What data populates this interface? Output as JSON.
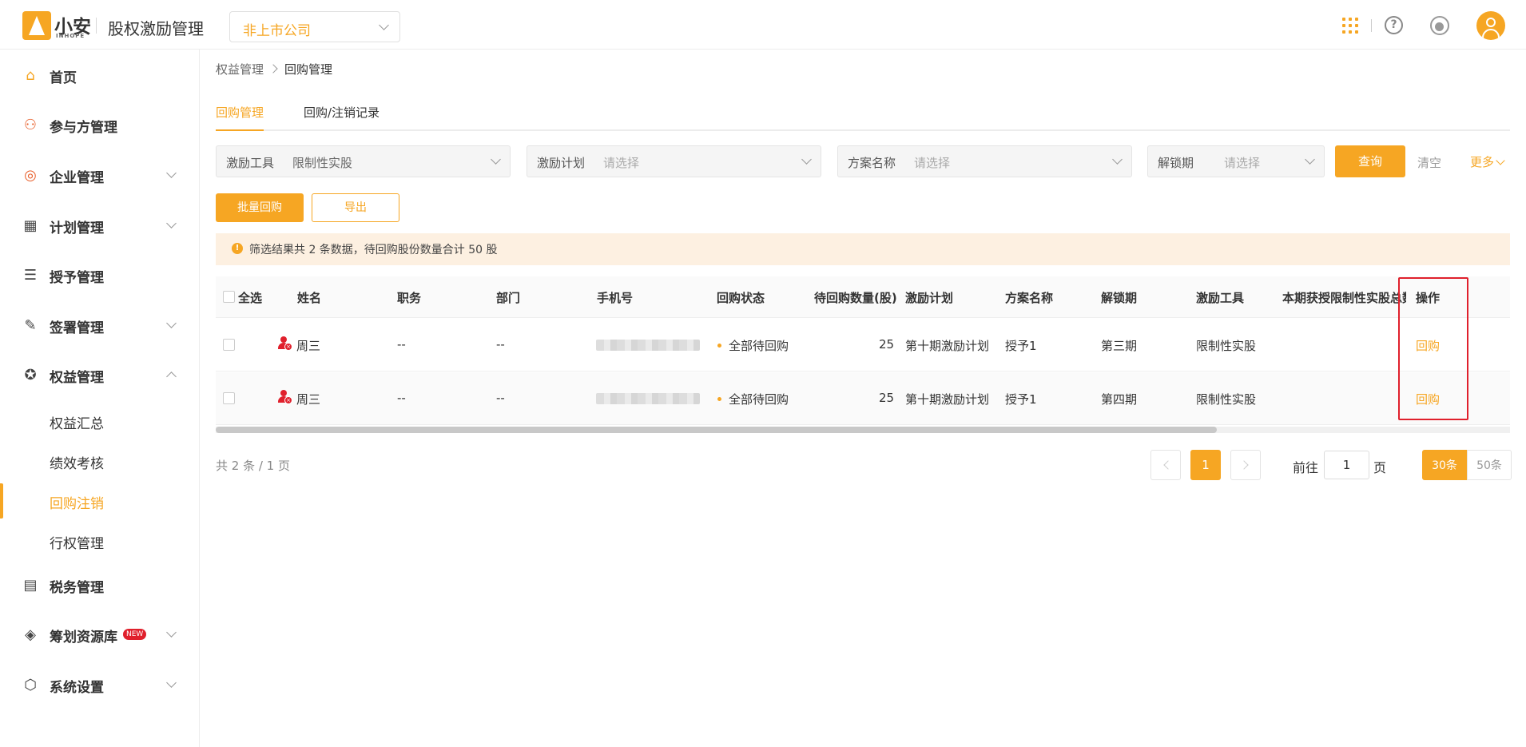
{
  "header": {
    "logo_text": "小安",
    "logo_sub": "INHOPE",
    "app_title": "股权激励管理",
    "company": "非上市公司"
  },
  "sidebar": {
    "items": [
      {
        "label": "首页",
        "icon": "home-icon",
        "has_children": false
      },
      {
        "label": "参与方管理",
        "icon": "users-icon",
        "has_children": false
      },
      {
        "label": "企业管理",
        "icon": "company-icon",
        "has_children": true
      },
      {
        "label": "计划管理",
        "icon": "plan-icon",
        "has_children": true
      },
      {
        "label": "授予管理",
        "icon": "grant-icon",
        "has_children": false
      },
      {
        "label": "签署管理",
        "icon": "sign-icon",
        "has_children": true
      },
      {
        "label": "权益管理",
        "icon": "equity-icon",
        "has_children": true,
        "expanded": true
      },
      {
        "label": "税务管理",
        "icon": "tax-icon",
        "has_children": false
      },
      {
        "label": "筹划资源库",
        "icon": "layers-icon",
        "has_children": true,
        "badge": "NEW"
      },
      {
        "label": "系统设置",
        "icon": "settings-icon",
        "has_children": true
      }
    ],
    "equity_children": [
      "权益汇总",
      "绩效考核",
      "回购注销",
      "行权管理"
    ],
    "active_child": "回购注销"
  },
  "breadcrumb": [
    "权益管理",
    "回购管理"
  ],
  "tabs": [
    "回购管理",
    "回购/注销记录"
  ],
  "active_tab": "回购管理",
  "filters": [
    {
      "label": "激励工具",
      "value": "限制性实股",
      "placeholder": ""
    },
    {
      "label": "激励计划",
      "value": "",
      "placeholder": "请选择"
    },
    {
      "label": "方案名称",
      "value": "",
      "placeholder": "请选择"
    },
    {
      "label": "解锁期",
      "value": "",
      "placeholder": "请选择"
    }
  ],
  "actions": {
    "query": "查询",
    "clear": "清空",
    "more": "更多",
    "batch": "批量回购",
    "export": "导出"
  },
  "alert": "筛选结果共 2 条数据，待回购股份数量合计 50 股",
  "table": {
    "select_all": "全选",
    "columns": [
      "姓名",
      "职务",
      "部门",
      "手机号",
      "回购状态",
      "待回购数量(股)",
      "激励计划",
      "方案名称",
      "解锁期",
      "激励工具",
      "本期获授限制性实股总数",
      "操作"
    ],
    "rows": [
      {
        "name": "周三",
        "title": "--",
        "dept": "--",
        "status": "全部待回购",
        "qty": "25",
        "plan": "第十期激励计划",
        "scheme": "授予1",
        "unlock": "第三期",
        "tool": "限制性实股",
        "op": "回购"
      },
      {
        "name": "周三",
        "title": "--",
        "dept": "--",
        "status": "全部待回购",
        "qty": "25",
        "plan": "第十期激励计划",
        "scheme": "授予1",
        "unlock": "第四期",
        "tool": "限制性实股",
        "op": "回购"
      }
    ]
  },
  "pagination": {
    "total": "共 2 条 / 1 页",
    "current": "1",
    "goto_label": "前往",
    "goto_value": "1",
    "page_unit": "页",
    "sizes": [
      "30条",
      "50条"
    ],
    "active_size": "30条"
  },
  "colors": {
    "accent": "#f6a623",
    "alert_bg": "#fdf0e1",
    "highlight": "#e0202c"
  }
}
